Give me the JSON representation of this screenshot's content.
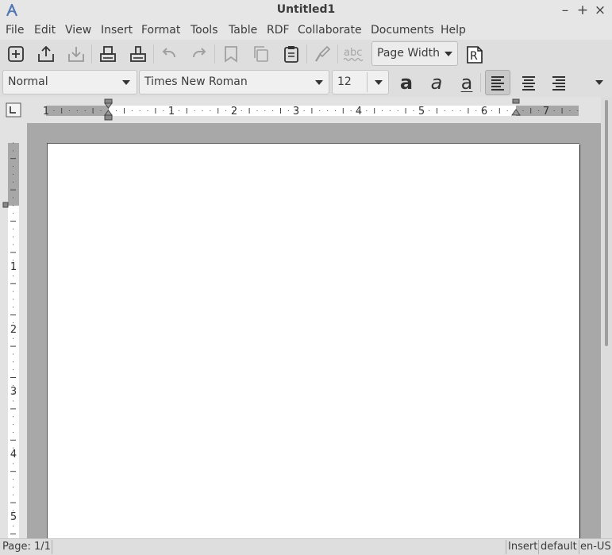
{
  "window": {
    "title": "Untitled1"
  },
  "menu": [
    "File",
    "Edit",
    "View",
    "Insert",
    "Format",
    "Tools",
    "Table",
    "RDF",
    "Collaborate",
    "Documents",
    "Help"
  ],
  "toolbar": {
    "zoom": "Page Width",
    "spell_label": "abc",
    "review_glyph": "R"
  },
  "format_bar": {
    "style": "Normal",
    "font": "Times New Roman",
    "size": "12",
    "bold_glyph": "a",
    "italic_glyph": "a",
    "underline_glyph": "a"
  },
  "ruler_h": {
    "labels": [
      "1",
      "1",
      "2",
      "3",
      "4",
      "5",
      "6",
      "7"
    ]
  },
  "ruler_v": {
    "labels": [
      "1",
      "2",
      "3",
      "4",
      "5"
    ]
  },
  "statusbar": {
    "page": "Page: 1/1",
    "mode": "Insert",
    "style": "default",
    "lang": "en-US"
  },
  "colors": {
    "accent": "#5077b4",
    "chrome": "#dedede",
    "canvas": "#a8a8a8"
  }
}
